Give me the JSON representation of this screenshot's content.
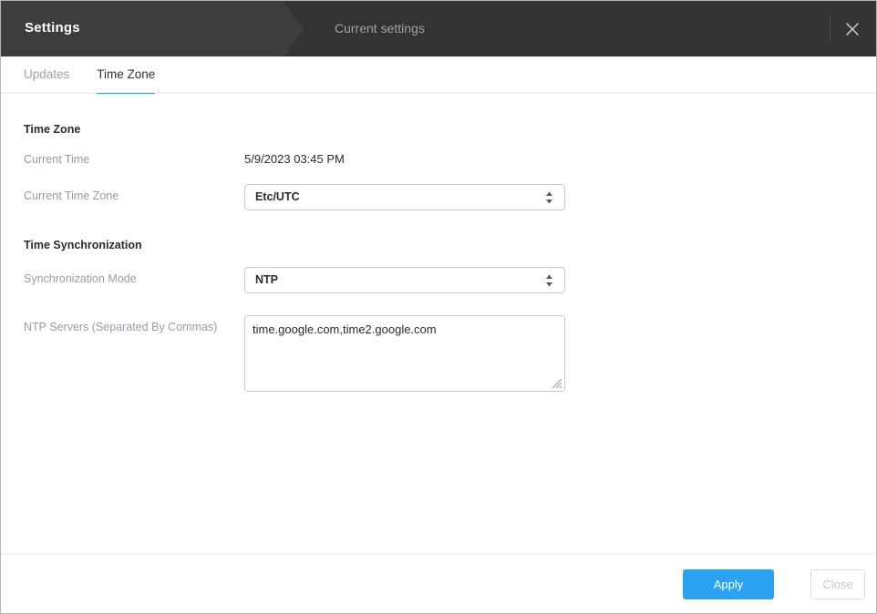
{
  "header": {
    "title": "Settings",
    "subtitle": "Current settings",
    "close_icon": "close-icon"
  },
  "tabs": [
    {
      "label": "Updates",
      "active": false
    },
    {
      "label": "Time Zone",
      "active": true
    }
  ],
  "sections": {
    "time_zone": {
      "title": "Time Zone",
      "current_time": {
        "label": "Current Time",
        "value": "5/9/2023 03:45 PM"
      },
      "current_time_zone": {
        "label": "Current Time Zone",
        "value": "Etc/UTC"
      }
    },
    "time_sync": {
      "title": "Time Synchronization",
      "sync_mode": {
        "label": "Synchronization Mode",
        "value": "NTP"
      },
      "ntp_servers": {
        "label": "NTP Servers (Separated By Commas)",
        "value": "time.google.com,time2.google.com",
        "placeholder": ""
      }
    }
  },
  "footer": {
    "apply_label": "Apply",
    "close_label": "Close"
  },
  "colors": {
    "accent": "#1eaaf1",
    "primary_button": "#2ba3f2",
    "header_bg": "#333333",
    "header_crumb_bg": "#3d3d3d",
    "label_text": "#939daa"
  }
}
